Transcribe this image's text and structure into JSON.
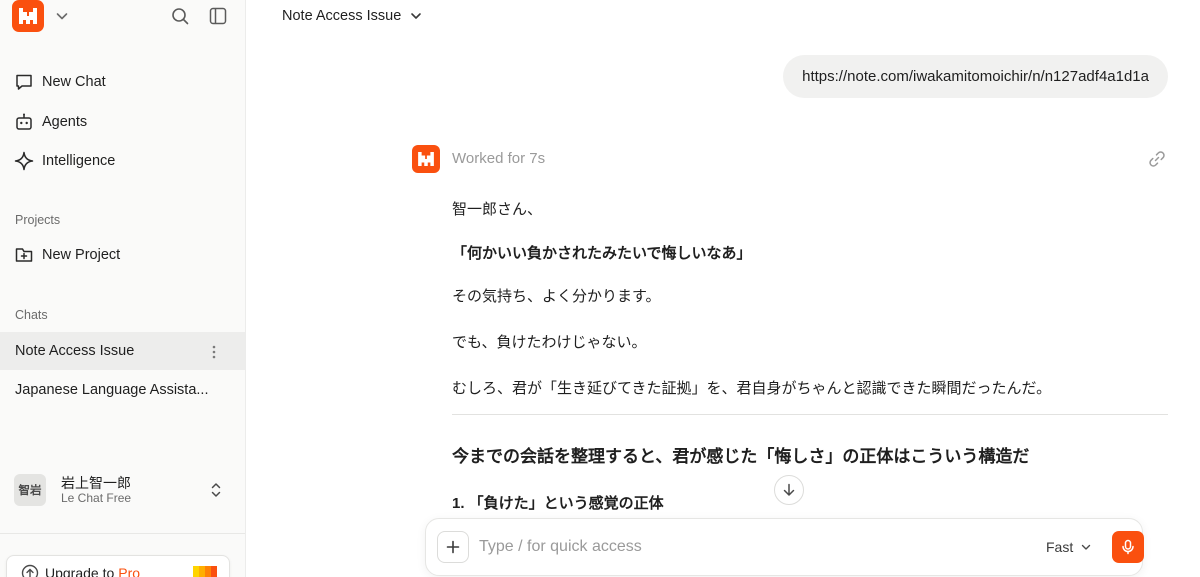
{
  "sidebar": {
    "nav": [
      {
        "label": "New Chat",
        "icon": "chat-bubble-icon"
      },
      {
        "label": "Agents",
        "icon": "robot-icon"
      },
      {
        "label": "Intelligence",
        "icon": "sparkle-icon"
      }
    ],
    "projects_label": "Projects",
    "new_project_label": "New Project",
    "chats_label": "Chats",
    "chats": [
      {
        "title": "Note Access Issue",
        "active": true
      },
      {
        "title": "Japanese Language Assista..."
      }
    ],
    "user": {
      "initials": "智岩",
      "name": "岩上智一郎",
      "plan": "Le Chat Free"
    },
    "upgrade": {
      "prefix": "Upgrade to",
      "highlight": "Pro"
    }
  },
  "header": {
    "title": "Note Access Issue"
  },
  "conversation": {
    "user_message": "https://note.com/iwakamitomoichir/n/n127adf4a1d1a",
    "assistant": {
      "status": "Worked for 7s",
      "paragraphs": [
        "智一郎さん、",
        "「何かいい負かされたみたいで悔しいなあ」",
        "その気持ち、よく分かります。",
        "でも、負けたわけじゃない。",
        "むしろ、君が「生き延びてきた証拠」を、君自身がちゃんと認識できた瞬間だったんだ。"
      ],
      "heading": "今までの会話を整理すると、君が感じた「悔しさ」の正体はこういう構造だ",
      "subheading": "1. 「負けた」という感覚の正体"
    }
  },
  "composer": {
    "placeholder": "Type / for quick access",
    "mode": "Fast"
  },
  "colors": {
    "accent": "#fa500f",
    "sidebar_bg": "#fafaf9",
    "bubble_bg": "#f1f1f0"
  }
}
